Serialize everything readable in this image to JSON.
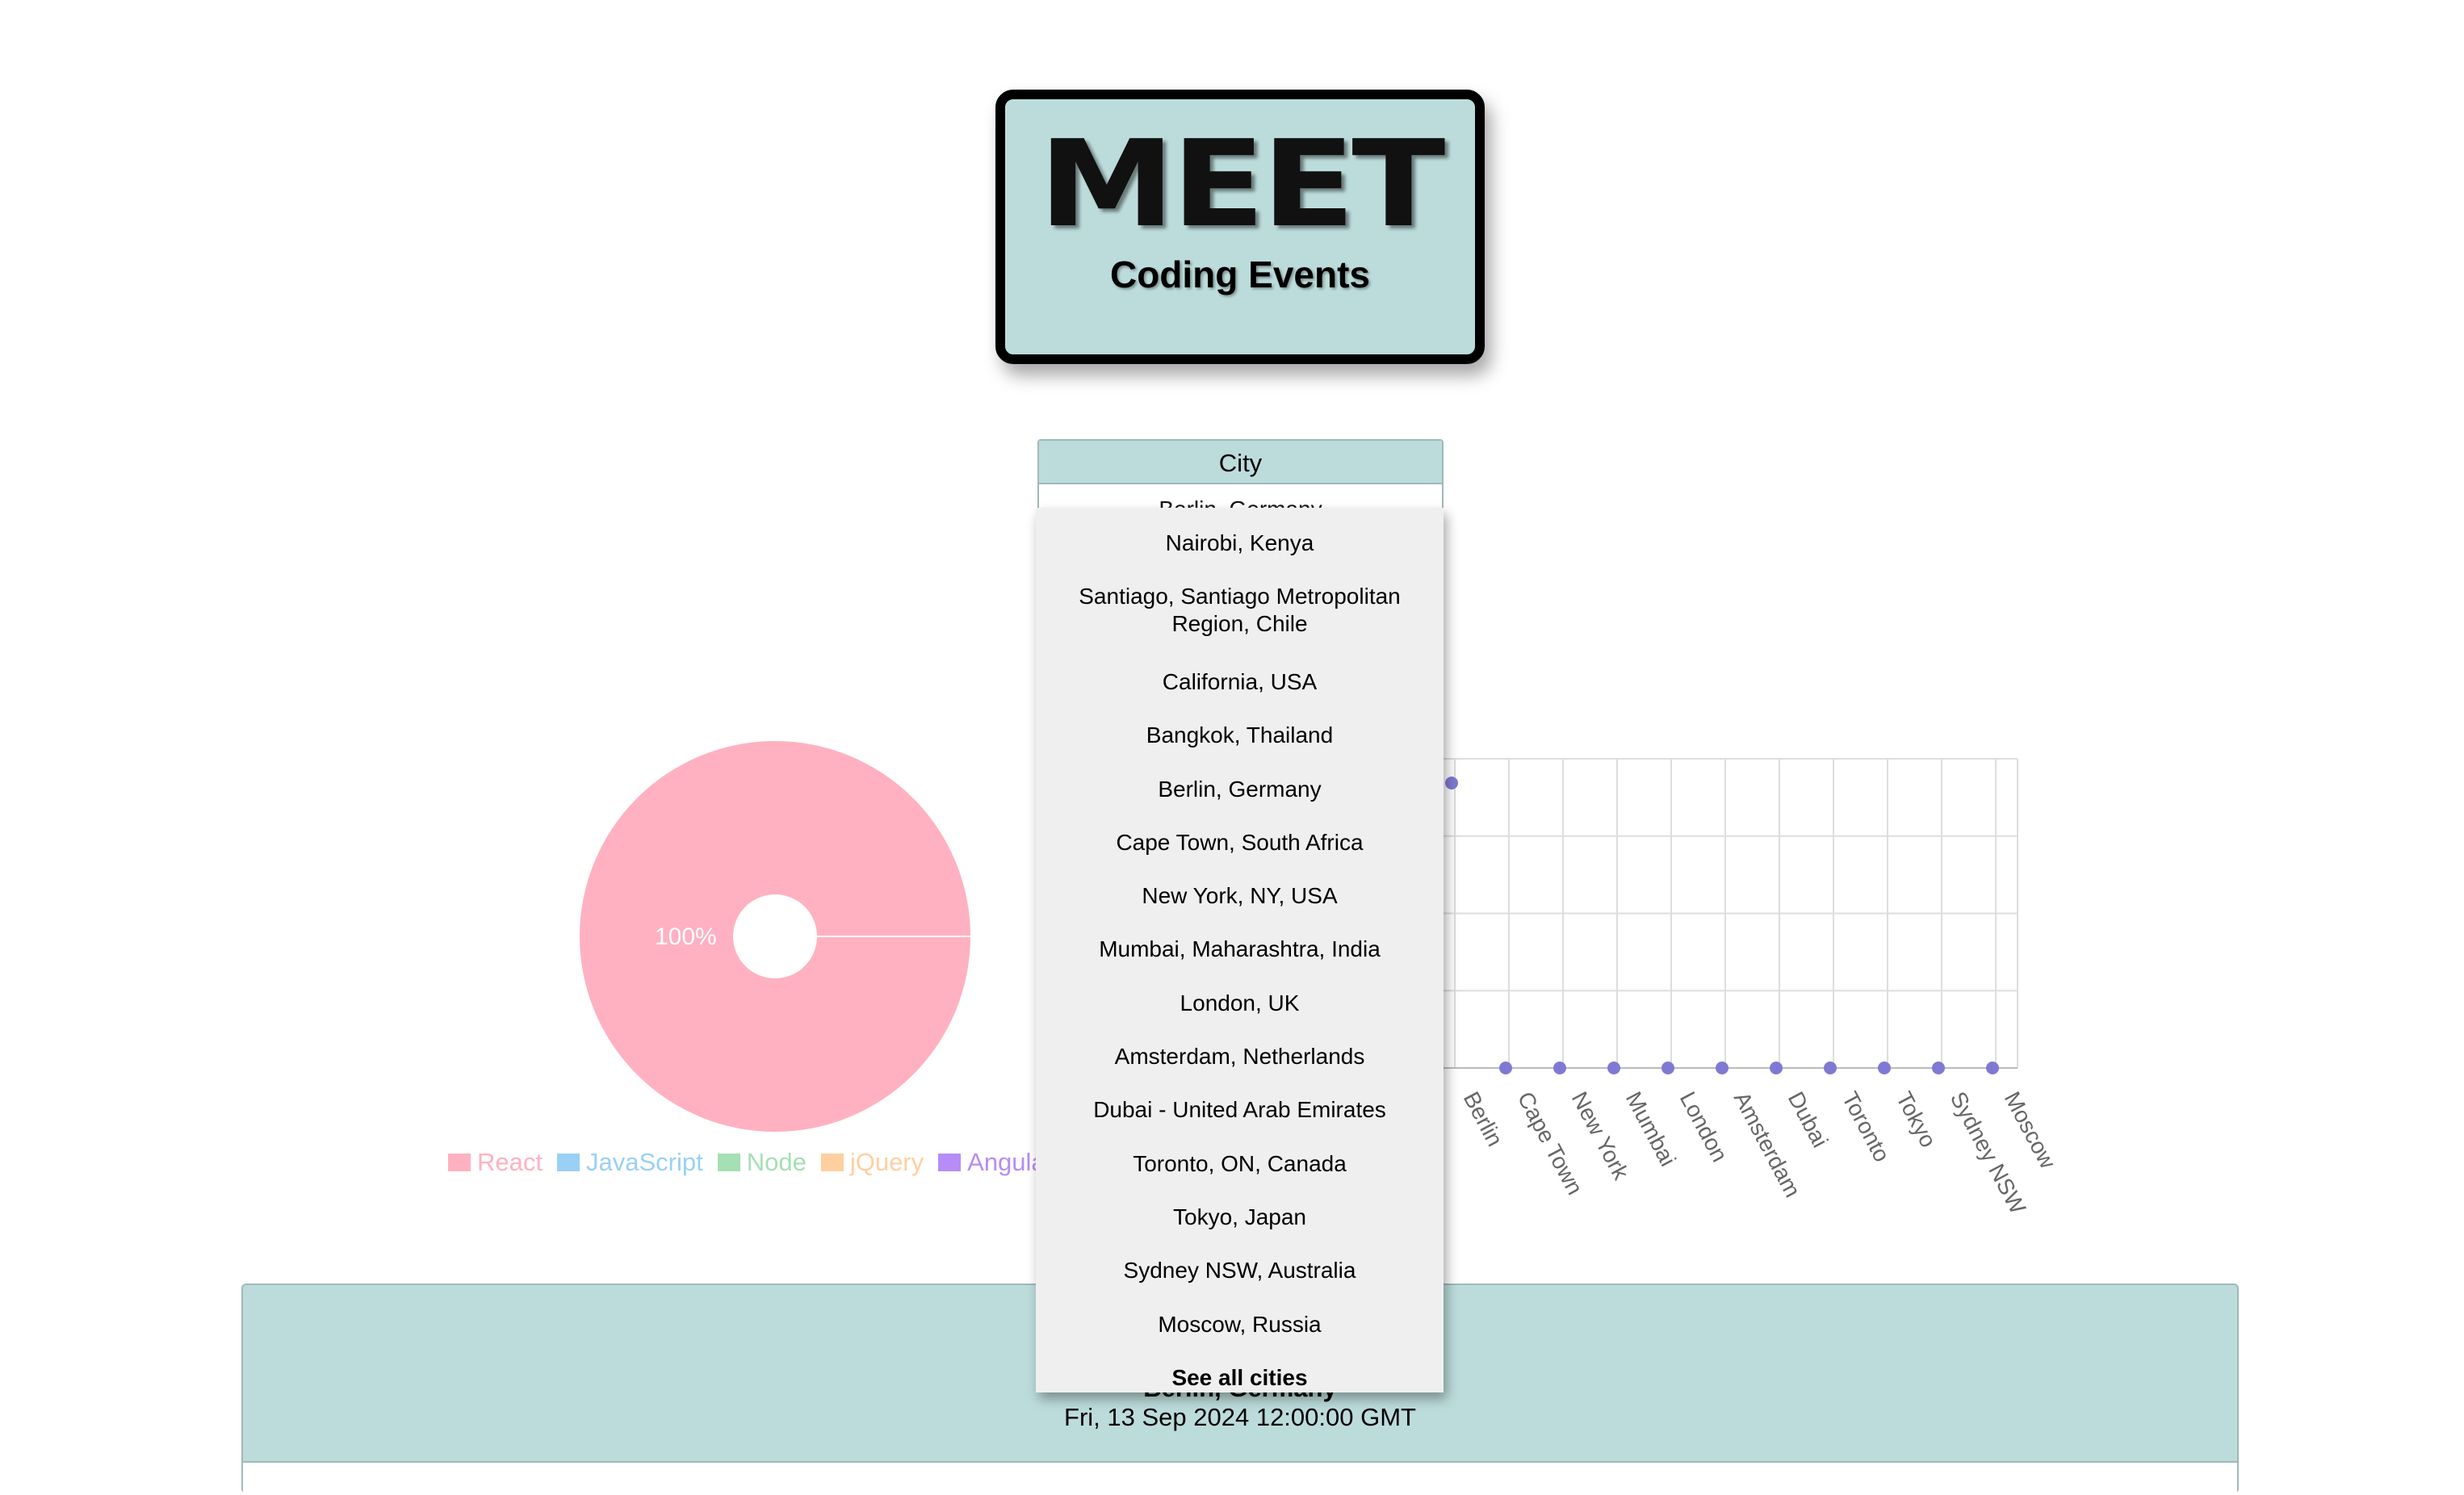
{
  "header": {
    "title": "MEET",
    "subtitle": "Coding Events"
  },
  "city_search": {
    "label": "City",
    "value": "Berlin, Germany"
  },
  "suggestions": [
    "Nairobi, Kenya",
    "Santiago, Santiago Metropolitan Region, Chile",
    "California, USA",
    "Bangkok, Thailand",
    "Berlin, Germany",
    "Cape Town, South Africa",
    "New York, NY, USA",
    "Mumbai, Maharashtra, India",
    "London, UK",
    "Amsterdam, Netherlands",
    "Dubai - United Arab Emirates",
    "Toronto, ON, Canada",
    "Tokyo, Japan",
    "Sydney NSW, Australia",
    "Moscow, Russia"
  ],
  "see_all_label": "See all cities",
  "colors": {
    "accent": "#bcdcdb",
    "pie_react": "#ffb1c1",
    "scatter_point": "#8079d4"
  },
  "chart_data": [
    {
      "type": "pie",
      "categories": [
        "React",
        "JavaScript",
        "Node",
        "jQuery",
        "Angular"
      ],
      "values": [
        100,
        0,
        0,
        0,
        0
      ],
      "slice_label": "100%",
      "legend": [
        {
          "label": "React",
          "color": "#ffb1c1"
        },
        {
          "label": "JavaScript",
          "color": "#9ad0f5"
        },
        {
          "label": "Node",
          "color": "#a5dfb4"
        },
        {
          "label": "jQuery",
          "color": "#ffcf9f"
        },
        {
          "label": "Angular",
          "color": "#b68cf6"
        }
      ],
      "legend_position": "bottom"
    },
    {
      "type": "scatter",
      "categories": [
        "Berlin",
        "Cape Town",
        "New York",
        "Mumbai",
        "London",
        "Amsterdam",
        "Dubai",
        "Toronto",
        "Tokyo",
        "Sydney NSW",
        "Moscow"
      ],
      "values": [
        1,
        0,
        0,
        0,
        0,
        0,
        0,
        0,
        0,
        0,
        0
      ],
      "grid": true
    }
  ],
  "event": {
    "location": "Berlin, Germany",
    "date": "Fri, 13 Sep 2024 12:00:00 GMT"
  }
}
